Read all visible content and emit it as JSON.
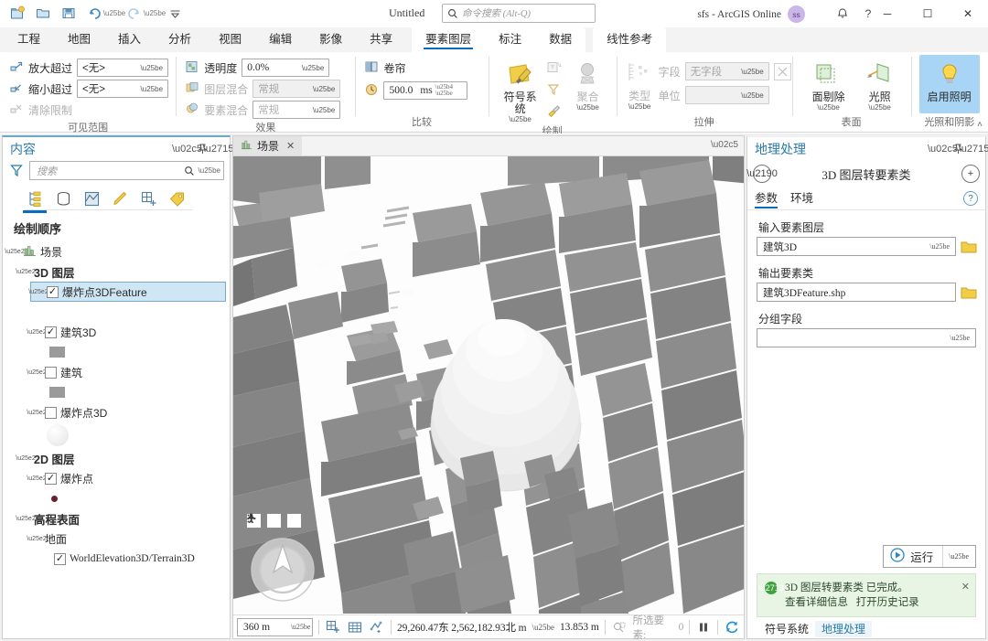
{
  "titlebar": {
    "quick_access": [
      {
        "name": "new-project-icon",
        "label": "新建工程"
      },
      {
        "name": "open-project-icon",
        "label": "打开工程"
      },
      {
        "name": "save-project-icon",
        "label": "保存工程"
      },
      {
        "name": "undo-icon",
        "label": "撤消"
      },
      {
        "name": "redo-icon",
        "label": "恢复"
      },
      {
        "name": "customize-quick-access-icon",
        "label": "自定义快速访问工具栏"
      }
    ],
    "document_title": "Untitled",
    "search_placeholder": "命令搜索 (Alt-Q)",
    "account_label": "sfs - ArcGIS Online",
    "avatar_initials": "ss",
    "notification_icon": "bell-icon",
    "help_label": "?",
    "minimize": "─",
    "maximize": "☐",
    "close": "✕"
  },
  "ribbon": {
    "tabs": [
      {
        "label": "工程",
        "active": false
      },
      {
        "label": "地图",
        "active": false
      },
      {
        "label": "插入",
        "active": false
      },
      {
        "label": "分析",
        "active": false
      },
      {
        "label": "视图",
        "active": false
      },
      {
        "label": "编辑",
        "active": false
      },
      {
        "label": "影像",
        "active": false
      },
      {
        "label": "共享",
        "active": false
      }
    ],
    "contextual_tabs": [
      {
        "label": "要素图层",
        "active": true
      },
      {
        "label": "标注",
        "active": false
      },
      {
        "label": "数据",
        "active": false
      }
    ],
    "contextual_tabs2": [
      {
        "label": "线性参考",
        "active": false
      }
    ],
    "groups": [
      {
        "title": "可见范围",
        "rows": [
          {
            "label": "放大超过",
            "icon": "zoom-in-beyond-icon",
            "value": "<无>",
            "disabled": false
          },
          {
            "label": "缩小超过",
            "icon": "zoom-out-beyond-icon",
            "value": "<无>",
            "disabled": false
          },
          {
            "label": "清除限制",
            "icon": "clear-limits-icon",
            "disabled": true
          }
        ]
      },
      {
        "title": "效果",
        "rows": [
          {
            "label": "透明度",
            "icon": "transparency-icon",
            "value": "0.0%",
            "disabled": false
          },
          {
            "label": "图层混合",
            "icon": "layer-blend-icon",
            "value": "常规",
            "disabled": true
          },
          {
            "label": "要素混合",
            "icon": "feature-blend-icon",
            "value": "常规",
            "disabled": true
          }
        ]
      },
      {
        "title": "比较",
        "rows": [
          {
            "label": "卷帘",
            "icon": "swipe-icon"
          },
          {
            "label": "闪烁",
            "icon": "flicker-icon",
            "value": "500.0",
            "units": "ms"
          }
        ]
      },
      {
        "title": "绘制",
        "buttons": [
          {
            "label": "符号系统",
            "icon": "symbology-icon",
            "has_caret": true,
            "disabled": false
          },
          {
            "label": "聚合",
            "icon": "aggregation-icon",
            "has_caret": true,
            "disabled": true
          }
        ],
        "small_icons": [
          {
            "name": "display-filters-icon",
            "disabled": true
          },
          {
            "name": "filter-icon",
            "disabled": true
          },
          {
            "name": "symbol-tools-icon",
            "disabled": false
          }
        ]
      },
      {
        "title": "拉伸",
        "type_button": {
          "label": "类型",
          "icon": "extrusion-type-icon",
          "has_caret": true,
          "disabled": true
        },
        "rows": [
          {
            "label": "字段",
            "value": "无字段",
            "disabled": true
          },
          {
            "label": "单位",
            "value": "",
            "disabled": true
          }
        ],
        "expression_button": {
          "name": "expression-builder-icon",
          "disabled": true
        }
      },
      {
        "title": "表面",
        "buttons": [
          {
            "label": "面剔除",
            "icon": "face-culling-icon",
            "has_caret": true,
            "disabled": false
          },
          {
            "label": "光照",
            "icon": "lighting-icon",
            "has_caret": true,
            "disabled": false
          }
        ]
      },
      {
        "title": "光照和阴影",
        "buttons": [
          {
            "label": "启用照明",
            "icon": "enable-lighting-icon",
            "selected": true
          }
        ]
      }
    ],
    "collapse_label": "˄"
  },
  "contents_pane": {
    "title": "内容",
    "menu_icon": "chevron-down-icon",
    "pin_icon": "pin-icon",
    "close_icon": "close-icon",
    "filter_icon": "filter-funnel-icon",
    "search_placeholder": "搜索",
    "search_icon": "search-icon",
    "toolbar_icons": [
      {
        "name": "list-by-drawing-order-icon",
        "active": true
      },
      {
        "name": "list-by-data-source-icon",
        "active": false
      },
      {
        "name": "list-by-selection-icon",
        "active": false
      },
      {
        "name": "list-by-editing-icon",
        "active": false
      },
      {
        "name": "list-by-snapping-icon",
        "active": false
      },
      {
        "name": "list-by-labeling-icon",
        "active": false
      }
    ],
    "heading": "绘制顺序",
    "tree": [
      {
        "label": "场景",
        "indent": 0,
        "bold": false,
        "icon": "scene-icon",
        "type": "scene"
      },
      {
        "label": "3D 图层",
        "indent": 1,
        "bold": true,
        "type": "group"
      },
      {
        "label": "爆炸点3DFeature",
        "indent": 2,
        "checked": true,
        "selected": true,
        "type": "layer"
      },
      {
        "label": "",
        "indent": 3,
        "type": "swatch-blank"
      },
      {
        "label": "建筑3D",
        "indent": 2,
        "checked": true,
        "type": "layer"
      },
      {
        "label": "",
        "indent": 3,
        "type": "swatch-gray"
      },
      {
        "label": "建筑",
        "indent": 2,
        "checked": false,
        "type": "layer"
      },
      {
        "label": "",
        "indent": 3,
        "type": "swatch-gray"
      },
      {
        "label": "爆炸点3D",
        "indent": 2,
        "checked": false,
        "type": "layer"
      },
      {
        "label": "",
        "indent": 3,
        "type": "swatch-sphere"
      },
      {
        "label": "2D 图层",
        "indent": 1,
        "bold": true,
        "type": "group"
      },
      {
        "label": "爆炸点",
        "indent": 2,
        "checked": true,
        "type": "layer"
      },
      {
        "label": "",
        "indent": 3,
        "type": "swatch-dot"
      },
      {
        "label": "高程表面",
        "indent": 1,
        "bold": true,
        "type": "group"
      },
      {
        "label": "地面",
        "indent": 2,
        "type": "group2"
      },
      {
        "label": "WorldElevation3D/Terrain3D",
        "indent": 3,
        "checked": true,
        "type": "layer"
      }
    ]
  },
  "mapview": {
    "tab_label": "场景",
    "tab_icon": "scene-icon",
    "tab_close": "✕",
    "menu_icon": "chevron-down-icon",
    "nav_buttons": [
      {
        "name": "full-extent-icon"
      },
      {
        "name": "pan-navigate-icon"
      },
      {
        "name": "walk-mode-icon"
      }
    ],
    "compass_icon": "navigator-compass",
    "status": {
      "scale_value": "360 m",
      "icons": [
        {
          "name": "add-basemap-icon"
        },
        {
          "name": "grid-icon"
        },
        {
          "name": "link-views-icon"
        }
      ],
      "coordinates": "29,260.47东 2,562,182.93北 m",
      "coord_dropdown": "chevron-down-icon",
      "elevation": "13.853 m",
      "selection_icon": "selected-features-icon",
      "selection_label": "所选要素:",
      "selection_count": "0",
      "pause_icon": "pause-drawing-icon",
      "refresh_icon": "refresh-icon"
    }
  },
  "geoprocessing_pane": {
    "title": "地理处理",
    "menu_icon": "chevron-down-icon",
    "pin_icon": "pin-icon",
    "close_icon": "close-icon",
    "back_icon": "back-arrow-icon",
    "tool_name": "3D 图层转要素类",
    "add_icon": "add-icon",
    "tabs": [
      {
        "label": "参数",
        "active": true
      },
      {
        "label": "环境",
        "active": false
      }
    ],
    "help_icon": "help-icon",
    "fields": [
      {
        "label": "输入要素图层",
        "value": "建筑3D",
        "type": "combo",
        "browse": true
      },
      {
        "label": "输出要素类",
        "value": "建筑3DFeature.shp",
        "type": "text",
        "browse": true
      },
      {
        "label": "分组字段",
        "value": "",
        "type": "combo",
        "browse": false
      }
    ],
    "run_label": "运行",
    "run_icon": "run-play-icon",
    "message": {
      "status_icon": "success-check-icon",
      "line1": "3D 图层转要素类 已完成。",
      "link1": "查看详细信息",
      "link2": "打开历史记录",
      "close": "✕"
    },
    "bottom_tabs": [
      {
        "label": "符号系统",
        "active": false
      },
      {
        "label": "地理处理",
        "active": true
      }
    ]
  },
  "colors": {
    "accent": "#0a6cbc",
    "pane_title": "#2a7ba8",
    "ribbon_bg": "#f3f3f3",
    "selection": "#cfe6f5",
    "highlight": "#a8d4f5",
    "success_bg": "#e8f4e4",
    "building": "#8e8e8e",
    "avatar": "#cbb6e8"
  }
}
